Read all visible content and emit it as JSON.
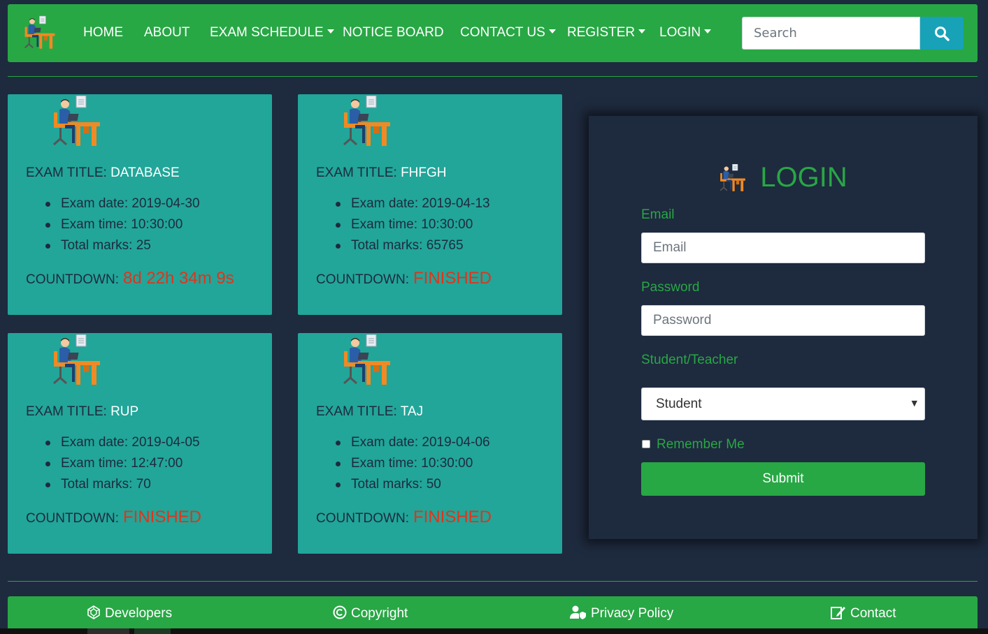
{
  "navbar": {
    "logo_icon": "exam-desk-logo-icon",
    "items": [
      {
        "label": "HOME",
        "dropdown": false
      },
      {
        "label": "ABOUT",
        "dropdown": false
      },
      {
        "label": "EXAM SCHEDULE",
        "dropdown": true
      },
      {
        "label": "NOTICE BOARD",
        "dropdown": false
      },
      {
        "label": "CONTACT US",
        "dropdown": true
      },
      {
        "label": "REGISTER",
        "dropdown": true
      },
      {
        "label": "LOGIN",
        "dropdown": true
      }
    ],
    "search": {
      "placeholder": "Search",
      "value": "",
      "button_icon": "search-icon"
    }
  },
  "exams": [
    {
      "title_label": "EXAM TITLE:",
      "name": "DATABASE",
      "date": "Exam date: 2019-04-30",
      "time": "Exam time: 10:30:00",
      "marks": "Total marks: 25",
      "countdown_label": "COUNTDOWN:",
      "countdown": "8d 22h 34m 9s"
    },
    {
      "title_label": "EXAM TITLE:",
      "name": "FHFGH",
      "date": "Exam date: 2019-04-13",
      "time": "Exam time: 10:30:00",
      "marks": "Total marks: 65765",
      "countdown_label": "COUNTDOWN:",
      "countdown": "FINISHED"
    },
    {
      "title_label": "EXAM TITLE:",
      "name": "RUP",
      "date": "Exam date: 2019-04-05",
      "time": "Exam time: 12:47:00",
      "marks": "Total marks: 70",
      "countdown_label": "COUNTDOWN:",
      "countdown": "FINISHED"
    },
    {
      "title_label": "EXAM TITLE:",
      "name": "TAJ",
      "date": "Exam date: 2019-04-06",
      "time": "Exam time: 10:30:00",
      "marks": "Total marks: 50",
      "countdown_label": "COUNTDOWN:",
      "countdown": "FINISHED"
    }
  ],
  "login": {
    "title": "LOGIN",
    "email_label": "Email",
    "email_placeholder": "Email",
    "password_label": "Password",
    "password_placeholder": "Password",
    "role_label": "Student/Teacher",
    "role_selected": "Student",
    "remember_label": "Remember Me",
    "remember_checked": false,
    "submit_label": "Submit"
  },
  "footer": {
    "items": [
      {
        "label": "Developers",
        "icon": "developers-icon"
      },
      {
        "label": "Copyright",
        "icon": "copyright-icon"
      },
      {
        "label": "Privacy Policy",
        "icon": "user-shield-icon"
      },
      {
        "label": "Contact",
        "icon": "edit-icon"
      }
    ]
  },
  "colors": {
    "background": "#1e2a3e",
    "brand_green": "#28a745",
    "card_teal": "#21a699",
    "search_button": "#17a2b8",
    "countdown_red": "#e0341c"
  }
}
